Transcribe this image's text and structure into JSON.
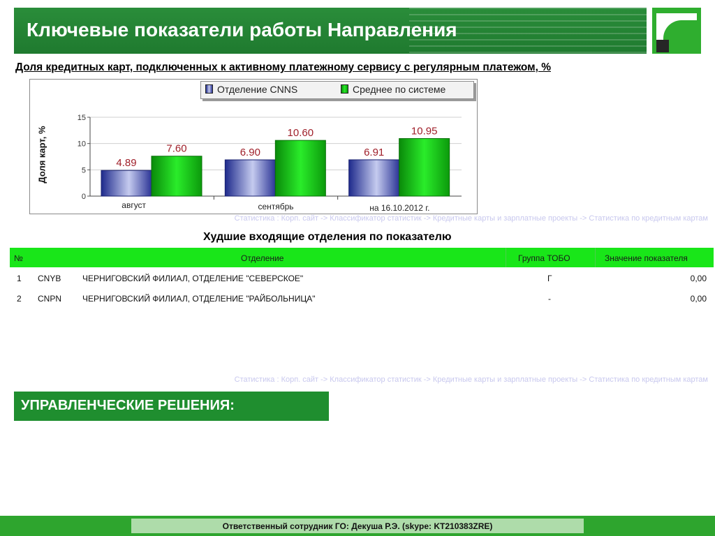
{
  "header": {
    "title": "Ключевые показатели работы Направления"
  },
  "subtitle": "Доля кредитных карт, подключенных к активному платежному сервису с регулярным платежом, %",
  "chart_data": {
    "type": "bar",
    "categories": [
      "август",
      "сентябрь",
      "на 16.10.2012 г."
    ],
    "series": [
      {
        "name": "Отделение CNNS",
        "values": [
          4.89,
          6.9,
          6.91
        ],
        "labels": [
          "4.89",
          "6.90",
          "6.91"
        ],
        "color": "#3a3fa6"
      },
      {
        "name": "Среднее по системе",
        "values": [
          7.6,
          10.6,
          10.95
        ],
        "labels": [
          "7.60",
          "10.60",
          "10.95"
        ],
        "color": "#1cc21c"
      }
    ],
    "ylabel": "Доля карт, %",
    "ylim": [
      0,
      15
    ],
    "yticks": [
      "0",
      "5",
      "10",
      "15"
    ],
    "grid": true,
    "legend_position": "top"
  },
  "source_text": "Статистика : Корп. сайт -> Классификатор статистик -> Кредитные карты и зарплатные проекты -> Статистика по кредитным картам",
  "table": {
    "title": "Худшие входящие отделения по показателю",
    "headers": {
      "num": "№",
      "branch": "Отделение",
      "group": "Группа ТОБО",
      "value": "Значение показателя"
    },
    "rows": [
      {
        "num": "1",
        "code": "CNYB",
        "name": "ЧЕРНИГОВСКИЙ ФИЛИАЛ, ОТДЕЛЕНИЕ \"СЕВЕРСКОЕ\"",
        "group": "Г",
        "value": "0,00"
      },
      {
        "num": "2",
        "code": "CNPN",
        "name": "ЧЕРНИГОВСКИЙ ФИЛИАЛ, ОТДЕЛЕНИЕ \"РАЙБОЛЬНИЦА\"",
        "group": "-",
        "value": "0,00"
      }
    ]
  },
  "decisions_label": "УПРАВЛЕНЧЕСКИЕ РЕШЕНИЯ:",
  "footer_text": "Ответственный сотрудник ГО: Декуша Р.Э. (skype: KT210383ZRE)"
}
